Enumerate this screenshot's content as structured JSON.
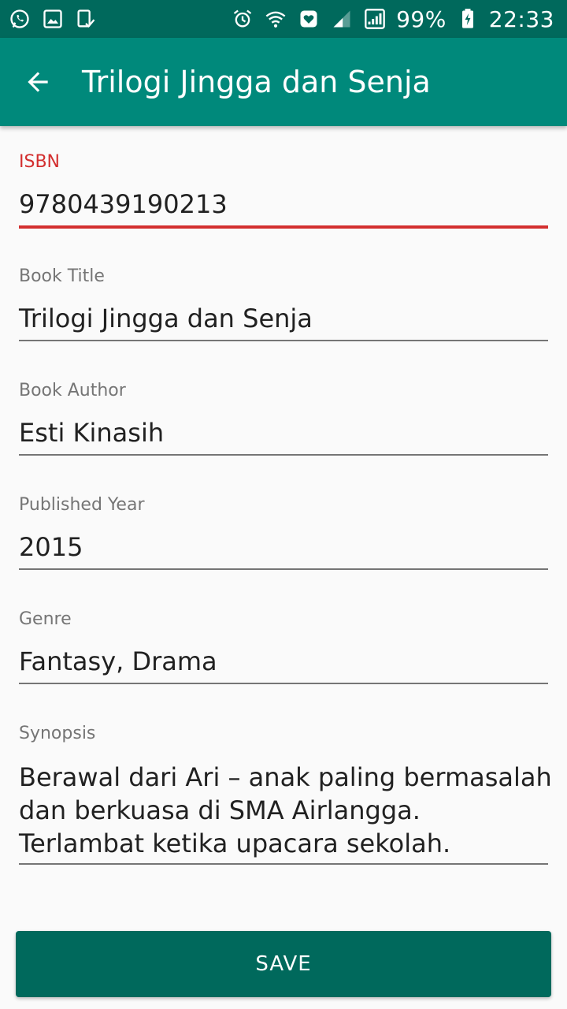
{
  "status_bar": {
    "left_icons": [
      "whatsapp-icon",
      "gallery-icon",
      "clipboard-check-icon"
    ],
    "right_icons": [
      "alarm-icon",
      "wifi-icon",
      "heart-shield-icon",
      "signal-icon",
      "signal-full-icon"
    ],
    "battery": "99%",
    "time": "22:33"
  },
  "app_bar": {
    "title": "Trilogi Jingga dan Senja",
    "back_icon": "arrow-back-icon"
  },
  "form": {
    "isbn": {
      "label": "ISBN",
      "value": "9780439190213"
    },
    "title": {
      "label": "Book Title",
      "value": "Trilogi Jingga dan Senja"
    },
    "author": {
      "label": "Book Author",
      "value": "Esti Kinasih"
    },
    "year": {
      "label": "Published Year",
      "value": "2015"
    },
    "genre": {
      "label": "Genre",
      "value": "Fantasy, Drama"
    },
    "synopsis": {
      "label": "Synopsis",
      "lines": [
        "Berawal dari Ari – anak paling bermasalah",
        "dan berkuasa di SMA Airlangga.",
        "Terlambat ketika upacara sekolah."
      ]
    }
  },
  "save_button": {
    "label": "SAVE"
  },
  "colors": {
    "status_bar": "#00695c",
    "app_bar": "#00897b",
    "error": "#d32f2f",
    "button": "#00695c"
  }
}
